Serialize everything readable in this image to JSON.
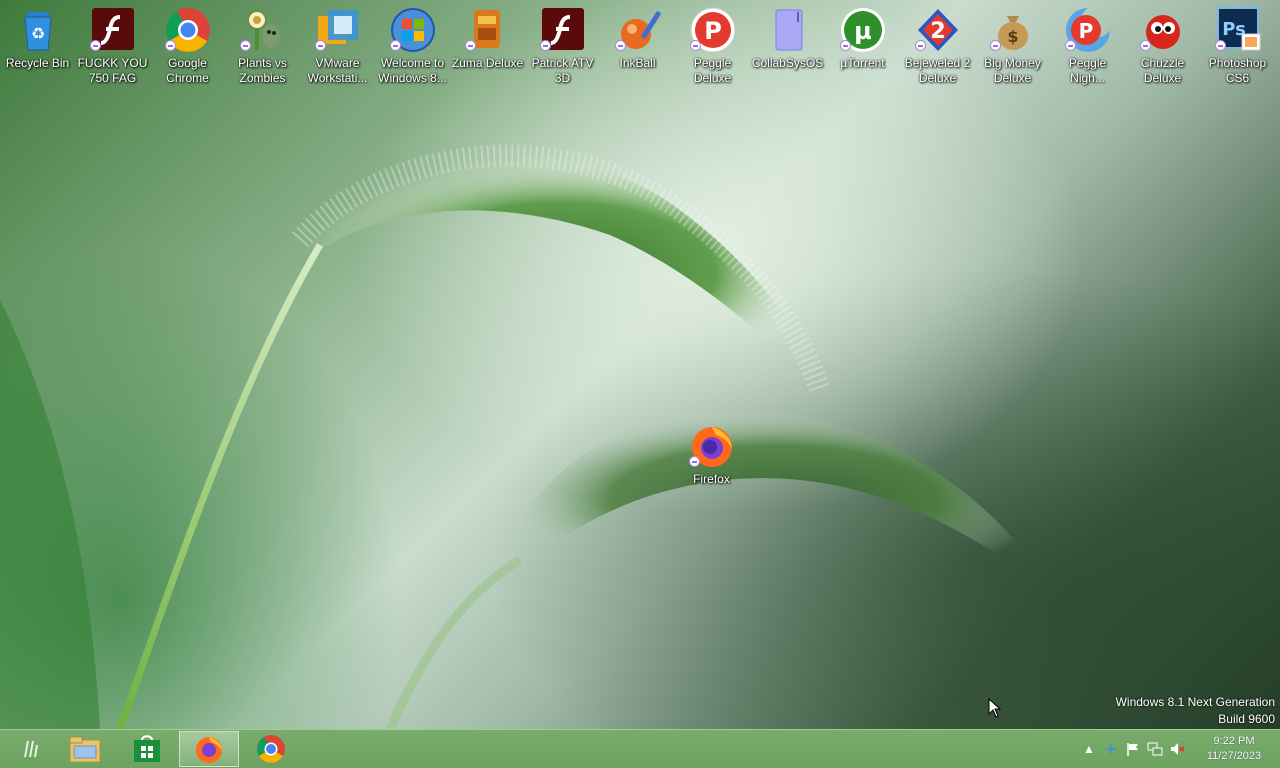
{
  "desktop": {
    "icons": [
      {
        "label": "Recycle Bin"
      },
      {
        "label": "FUCKK YOU 750 FAG"
      },
      {
        "label": "Google Chrome"
      },
      {
        "label": "Plants vs Zombies"
      },
      {
        "label": "VMware Workstati..."
      },
      {
        "label": "Welcome to Windows 8..."
      },
      {
        "label": "Zuma Deluxe"
      },
      {
        "label": "Patrick ATV 3D"
      },
      {
        "label": "InkBall"
      },
      {
        "label": "Peggle Deluxe"
      },
      {
        "label": "CollabSysOS"
      },
      {
        "label": "µTorrent"
      },
      {
        "label": "Bejeweled 2 Deluxe"
      },
      {
        "label": "Big Money Deluxe"
      },
      {
        "label": "Peggle Nigh..."
      },
      {
        "label": "Chuzzle Deluxe"
      },
      {
        "label": "Photoshop CS6"
      }
    ],
    "firefox_icon": {
      "label": "Firefox"
    }
  },
  "watermark": {
    "line1": "Windows 8.1 Next Generation",
    "line2": "Build 9600"
  },
  "taskbar": {
    "pinned": [
      "start-icon",
      "file-explorer-icon",
      "store-icon",
      "firefox-icon",
      "chrome-icon"
    ],
    "clock": {
      "time": "9:22 PM",
      "date": "11/27/2023"
    }
  },
  "colors": {
    "taskbar": "#6ca360",
    "accent": "#9ccf8f"
  }
}
